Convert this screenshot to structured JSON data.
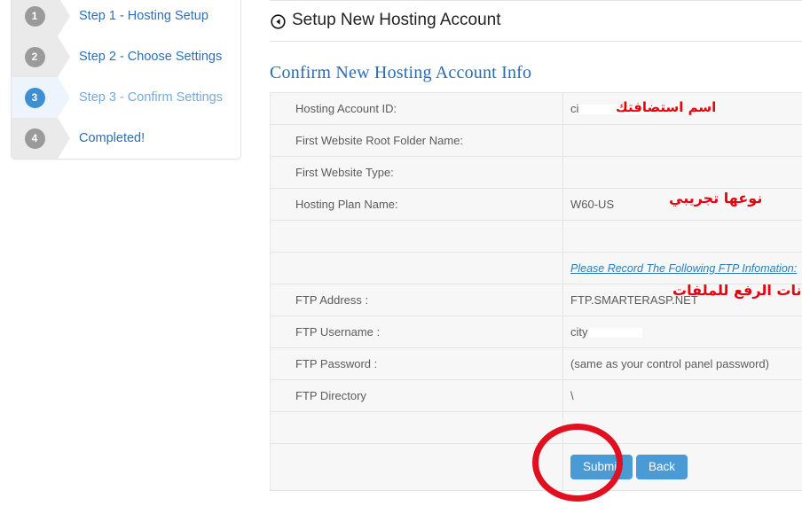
{
  "wizard": {
    "steps": [
      {
        "number": "1",
        "label": "Step 1 - Hosting Setup",
        "active": false
      },
      {
        "number": "2",
        "label": "Step 2 - Choose Settings",
        "active": false
      },
      {
        "number": "3",
        "label": "Step 3 - Confirm Settings",
        "active": true
      },
      {
        "number": "4",
        "label": "Completed!",
        "active": false
      }
    ]
  },
  "header": {
    "title": "Setup New Hosting Account",
    "back_icon": "circled-back-arrow-icon"
  },
  "section": {
    "title": "Confirm New Hosting Account Info"
  },
  "table": {
    "rows": [
      {
        "label": "Hosting Account ID:",
        "value": "ci",
        "redacted": true
      },
      {
        "label": "First Website Root Folder Name:",
        "value": ""
      },
      {
        "label": "First Website Type:",
        "value": ""
      },
      {
        "label": "Hosting Plan Name:",
        "value": "W60-US"
      },
      {
        "label": "",
        "value": ""
      },
      {
        "label": "",
        "value": "Please Record The Following FTP Infomation:",
        "note": true
      },
      {
        "label": "FTP Address :",
        "value": "FTP.SMARTERASP.NET"
      },
      {
        "label": "FTP Username :",
        "value": "city",
        "redacted": true
      },
      {
        "label": "FTP Password :",
        "value": "(same as your control panel password)"
      },
      {
        "label": "FTP Directory",
        "value": "\\"
      },
      {
        "label": "",
        "value": ""
      }
    ]
  },
  "buttons": {
    "submit": "Submit",
    "back": "Back"
  },
  "annotations": {
    "account_name": "اسم استضافتك",
    "plan_type": "نوعها تجريبي",
    "ftp_info": "بيانات الرفع للملفات",
    "highlight_color": "#e01020"
  },
  "colors": {
    "accent_blue": "#4a9ad6",
    "link_blue": "#2f6fb5",
    "active_step": "#3d8fd1",
    "annotation_red": "#e8000d",
    "table_bg": "#f7f7f7"
  }
}
